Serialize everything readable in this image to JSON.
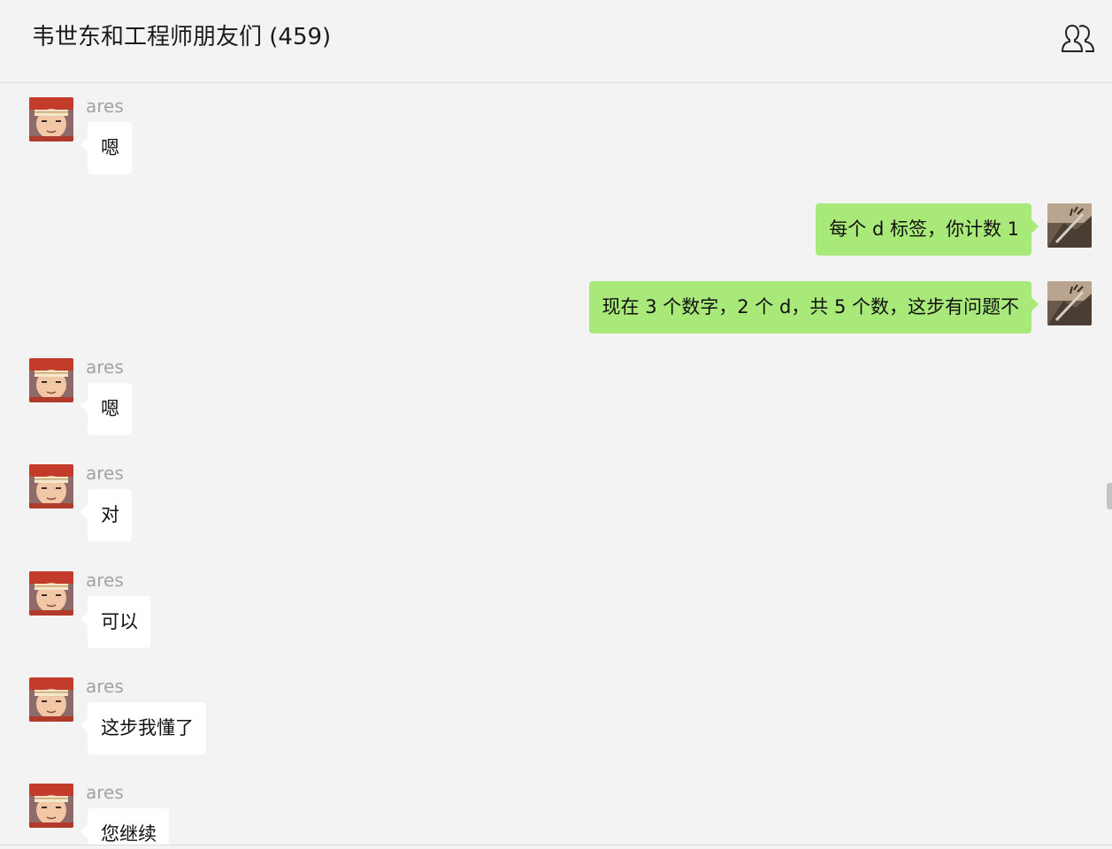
{
  "header": {
    "title": "韦世东和工程师朋友们 (459)",
    "members_icon": "group-members-icon"
  },
  "colors": {
    "background": "#f3f3f3",
    "incoming_bubble": "#ffffff",
    "outgoing_bubble": "#a9e97a",
    "sender_name": "#a3a3a3"
  },
  "messages": [
    {
      "direction": "in",
      "sender": "ares",
      "text": "嗯"
    },
    {
      "direction": "out",
      "sender": "",
      "text": "每个 d 标签，你计数 1"
    },
    {
      "direction": "out",
      "sender": "",
      "text": "现在 3 个数字，2 个 d，共 5 个数，这步有问题不"
    },
    {
      "direction": "in",
      "sender": "ares",
      "text": "嗯"
    },
    {
      "direction": "in",
      "sender": "ares",
      "text": "对"
    },
    {
      "direction": "in",
      "sender": "ares",
      "text": "可以"
    },
    {
      "direction": "in",
      "sender": "ares",
      "text": "这步我懂了"
    },
    {
      "direction": "in",
      "sender": "ares",
      "text": "您继续"
    }
  ]
}
